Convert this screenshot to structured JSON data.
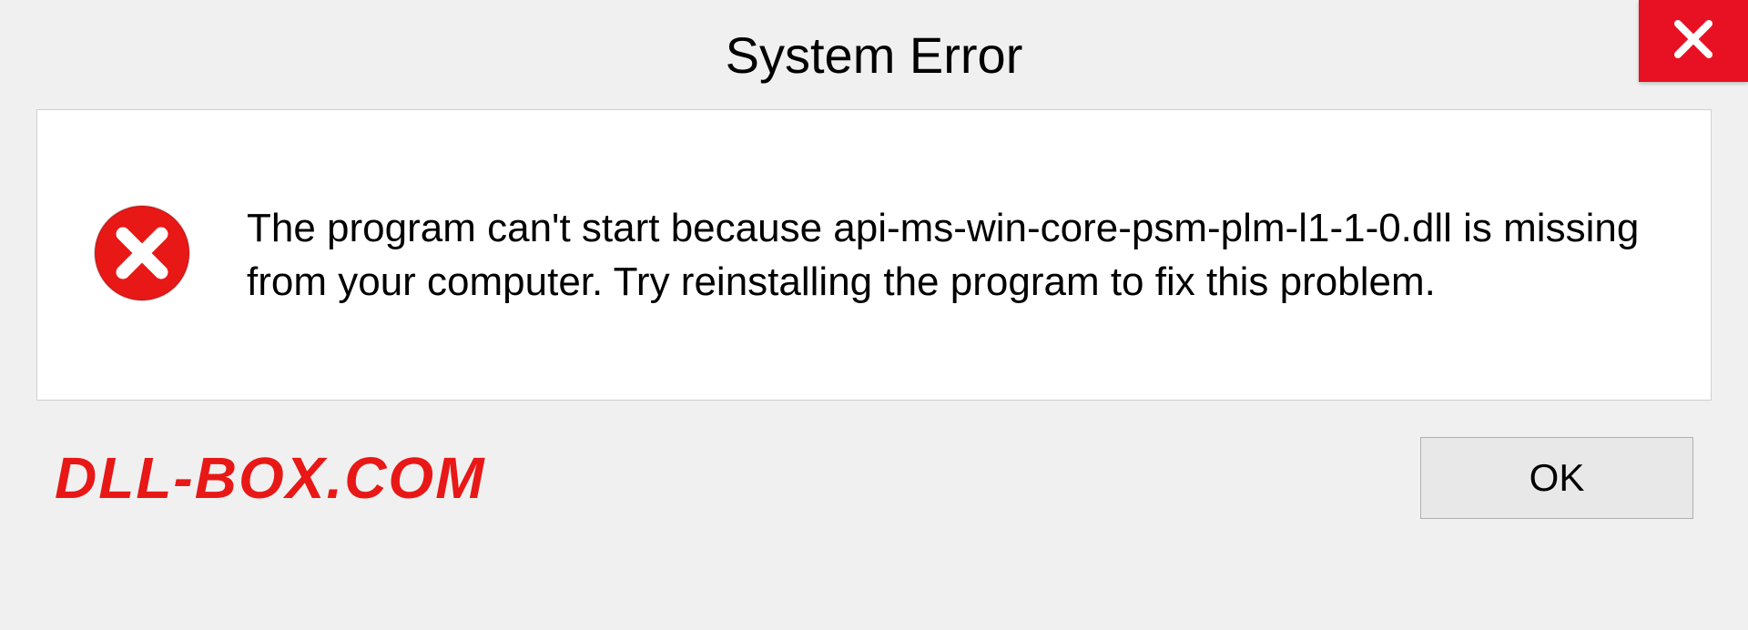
{
  "dialog": {
    "title": "System Error",
    "message": "The program can't start because api-ms-win-core-psm-plm-l1-1-0.dll is missing from your computer. Try reinstalling the program to fix this problem.",
    "ok_label": "OK"
  },
  "watermark": "DLL-BOX.COM",
  "colors": {
    "close_bg": "#e81123",
    "error_icon": "#e81123",
    "watermark": "#e81817"
  }
}
